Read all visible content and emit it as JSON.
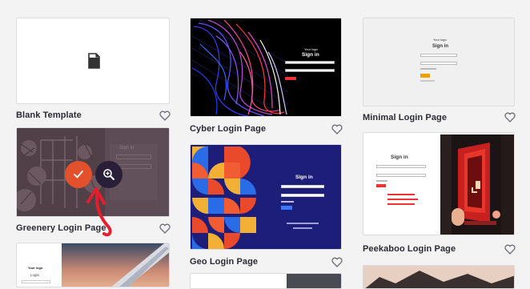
{
  "templates": [
    {
      "title": "Blank Template"
    },
    {
      "title": "Cyber Login Page",
      "preview": {
        "logo": "Your logo",
        "heading": "Sign in"
      }
    },
    {
      "title": "Minimal Login Page",
      "preview": {
        "logo": "Your logo",
        "heading": "Sign in"
      }
    },
    {
      "title": "Greenery Login Page",
      "preview": {
        "heading": "Sign in"
      }
    },
    {
      "title": "Geo Login Page",
      "preview": {
        "heading": "Sign in"
      }
    },
    {
      "title": "Peekaboo Login Page",
      "preview": {
        "heading": "Sign in"
      }
    },
    {
      "title": "",
      "preview": {
        "logo": "Your logo",
        "heading": "Login"
      }
    }
  ],
  "colors": {
    "page_bg": "#f3f3f4",
    "select_button": "#e2512b",
    "zoom_button": "#2a1f38",
    "annotation_arrow": "#e41e2b",
    "heart_stroke": "#6b6b76"
  },
  "icons": {
    "select": "checkmark-icon",
    "preview": "zoom-in-icon",
    "favorite": "heart-icon",
    "blank": "document-icon"
  }
}
